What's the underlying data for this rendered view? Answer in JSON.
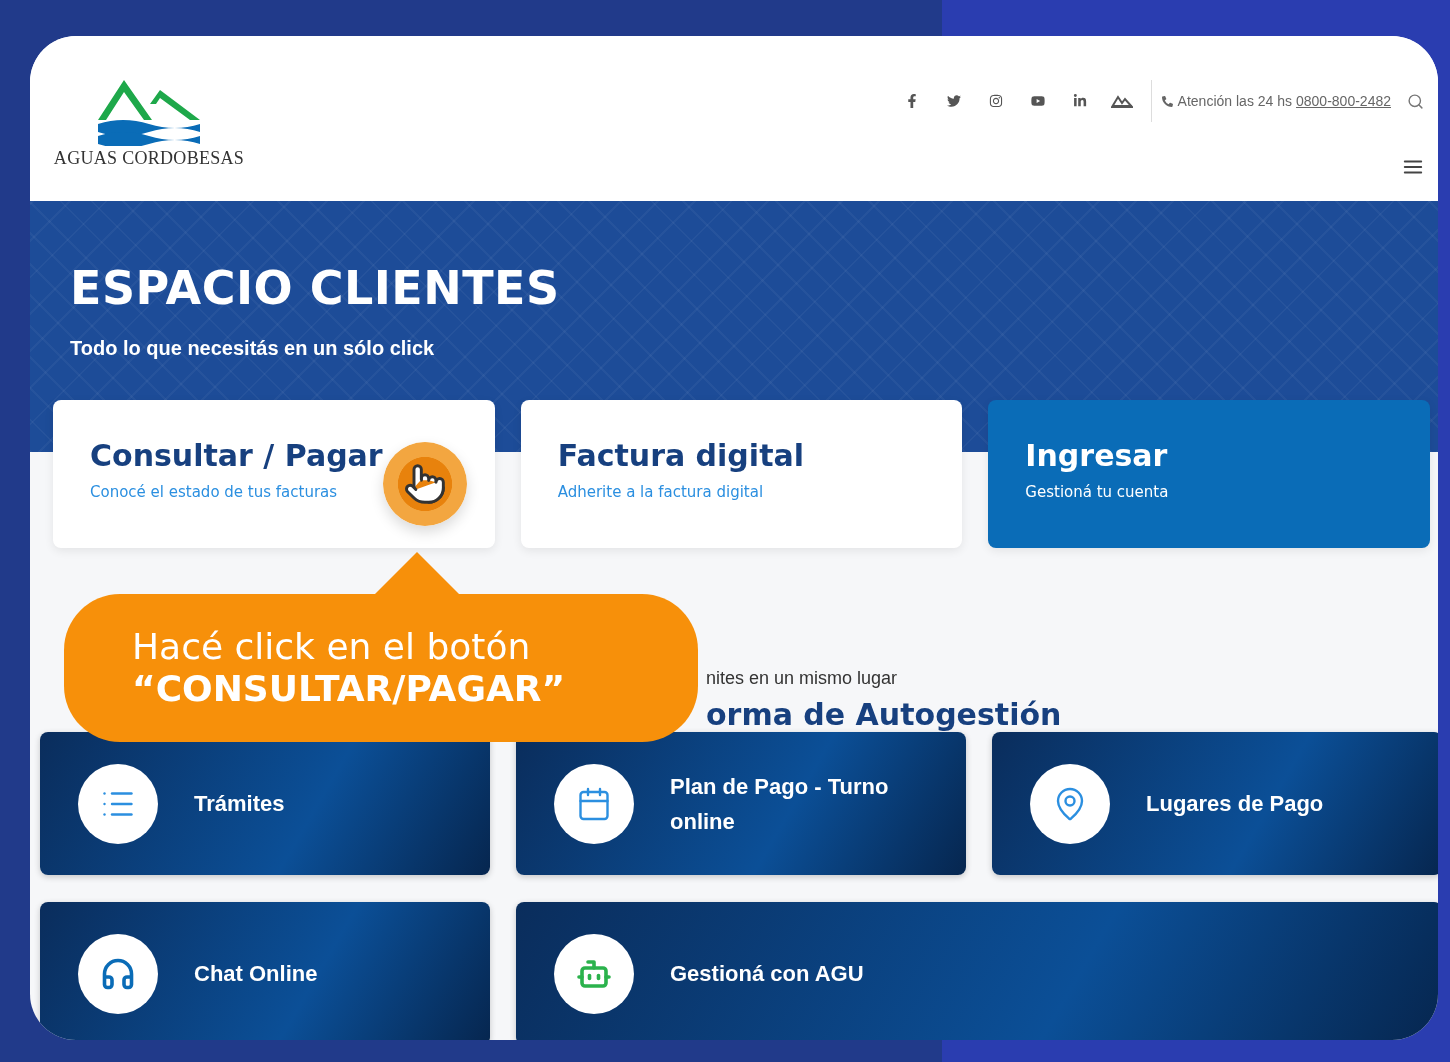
{
  "logo": {
    "wordmark": "AGUAS CORDOBESAS"
  },
  "header": {
    "social": [
      {
        "kind": "facebook"
      },
      {
        "kind": "twitter"
      },
      {
        "kind": "instagram"
      },
      {
        "kind": "youtube"
      },
      {
        "kind": "linkedin"
      },
      {
        "kind": "mountains"
      }
    ],
    "attention": "Atención las 24 hs",
    "phone": "0800-800-2482"
  },
  "hero": {
    "title": "ESPACIO CLIENTES",
    "subtitle": "Todo lo que necesitás en un sólo click"
  },
  "action_cards": [
    {
      "title": "Consultar / Pagar",
      "subtitle": "Conocé el estado de tus facturas",
      "kind": "light",
      "pointer": true
    },
    {
      "title": "Factura digital",
      "subtitle": "Adherite a la factura digital",
      "kind": "light",
      "pointer": false
    },
    {
      "title": "Ingresar",
      "subtitle": "Gestioná tu cuenta",
      "kind": "primary",
      "pointer": false
    }
  ],
  "callout": {
    "line_1": "Hacé click en el botón",
    "line_2": "“CONSULTAR/PAGAR”"
  },
  "section": {
    "eyebrow": "nites en un mismo lugar",
    "title": "orma de Autogestión"
  },
  "tiles": [
    {
      "title": "Trámites"
    },
    {
      "title": "Plan de Pago - Turno online"
    },
    {
      "title": "Lugares de Pago"
    },
    {
      "title": "Chat Online"
    },
    {
      "title": "Gestioná con AGU"
    }
  ]
}
